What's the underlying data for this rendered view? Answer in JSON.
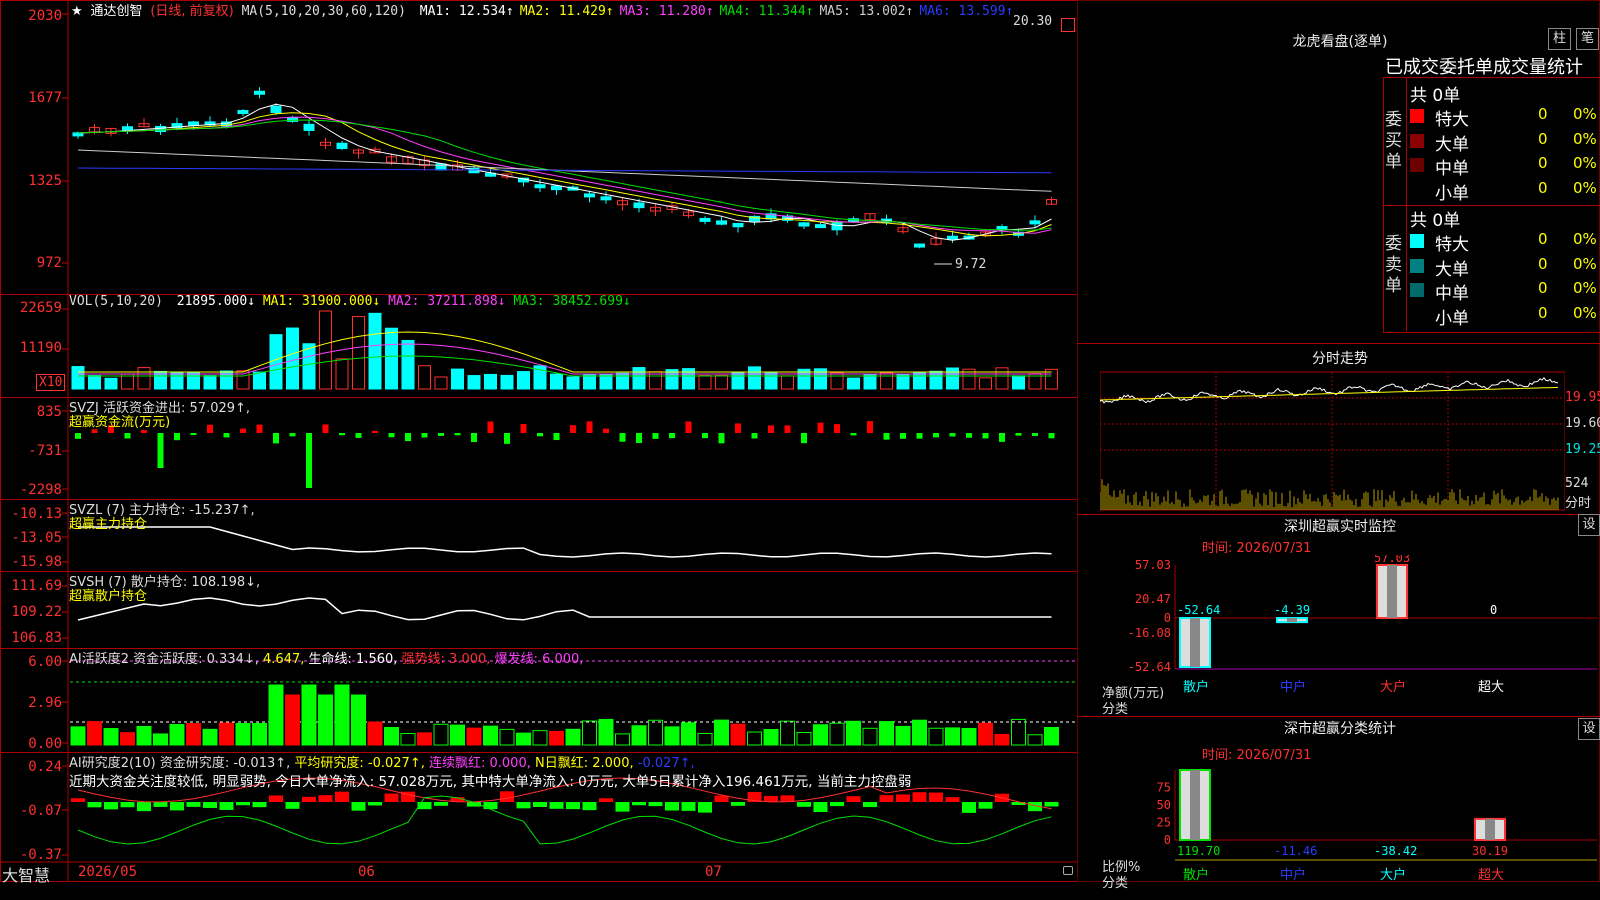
{
  "stock": {
    "star": "★",
    "name": "通达创智",
    "mode": "(日线, 前复权)",
    "ma_label": "MA(5,10,20,30,60,120)",
    "ma_values": [
      {
        "text": "MA1: 12.534↑",
        "color": "#ffffff"
      },
      {
        "text": "MA2: 11.429↑",
        "color": "#ffff00"
      },
      {
        "text": "MA3: 11.280↑",
        "color": "#ff40ff"
      },
      {
        "text": "MA4: 11.344↑",
        "color": "#00e000"
      },
      {
        "text": "MA5: 13.002↑",
        "color": "#cccccc"
      },
      {
        "text": "MA6: 13.599↑",
        "color": "#2a3cff"
      }
    ],
    "price_axis": [
      "2030",
      "1677",
      "1325",
      "972"
    ],
    "high_label": "20.30",
    "low_label": "9.72"
  },
  "vol": {
    "header": "VOL(5,10,20)",
    "v1": "21895.000↓",
    "ma1": "MA1: 31900.000↓",
    "ma2": "MA2: 37211.898↓",
    "ma3": "MA3: 38452.699↓",
    "axis": [
      "22659",
      "11190"
    ],
    "unit": "X10"
  },
  "svzj": {
    "header": "SVZJ  活跃资金进出: 57.029↑,",
    "sub": "超赢资金流(万元)",
    "axis": [
      "835",
      "-731",
      "-2298"
    ]
  },
  "svzl": {
    "header": "SVZL (7) 主力持仓: -15.237↑,",
    "sub": "超赢主力持仓",
    "axis": [
      "-10.13",
      "-13.05",
      "-15.98"
    ]
  },
  "svsh": {
    "header": "SVSH (7) 散户持仓: 108.198↓,",
    "sub": "超赢散户持仓",
    "axis": [
      "111.69",
      "109.22",
      "106.83"
    ]
  },
  "ai2": {
    "label": "AI活跃度2 资金活跃度: 0.334↓,",
    "v2": "4.647,",
    "life": "生命线: 1.560,",
    "strong": "强势线: 3.000,",
    "burst": "爆发线: 6.000,",
    "axis": [
      "6.00",
      "2.96",
      "0.00"
    ]
  },
  "ai_research": {
    "label": "AI研究度2(10) 资金研究度: -0.013↑,",
    "avg": "平均研究度: -0.027↑,",
    "lianxu": "连续飘红: 0.000,",
    "nday": "N日飘红: 2.000,",
    "last": "-0.027↑,",
    "comment": "近期大资金关注度较低, 明显弱势, 今日大单净流入: 57.028万元, 其中特大单净流入: 0万元, 大单5日累计净入196.461万元, 当前主力控盘弱",
    "axis": [
      "0.24",
      "-0.07",
      "-0.37"
    ]
  },
  "xaxis": {
    "brand": "大智慧",
    "labels": [
      "2026/05",
      "06",
      "07"
    ]
  },
  "right": {
    "dragon_title": "龙虎看盘(逐单)",
    "btn_bar": "柱",
    "btn_count": "笔",
    "stat_title": "已成交委托单成交量统计",
    "buy_side": "委买单",
    "sell_side": "委卖单",
    "buy_total": "共 0单",
    "sell_total": "共 0单",
    "buy_rows": [
      {
        "label": "特大",
        "n": "0",
        "pct": "0%",
        "color": "#ff0000"
      },
      {
        "label": "大单",
        "n": "0",
        "pct": "0%",
        "color": "#8b0000"
      },
      {
        "label": "中单",
        "n": "0",
        "pct": "0%",
        "color": "#6a0000"
      },
      {
        "label": "小单",
        "n": "0",
        "pct": "0%",
        "color": "#000000"
      }
    ],
    "sell_rows": [
      {
        "label": "特大",
        "n": "0",
        "pct": "0%",
        "color": "#00ffff"
      },
      {
        "label": "大单",
        "n": "0",
        "pct": "0%",
        "color": "#008080"
      },
      {
        "label": "中单",
        "n": "0",
        "pct": "0%",
        "color": "#006a6a"
      },
      {
        "label": "小单",
        "n": "0",
        "pct": "0%",
        "color": "#000000"
      }
    ],
    "intraday_title": "分时走势",
    "intraday_axis": [
      "19.95",
      "19.60",
      "19.25"
    ],
    "intraday_vol": "524",
    "intraday_unit": "分时",
    "monitor_title": "深圳超赢实时监控",
    "monitor_btn": "设",
    "monitor_time": "时间: 2026/07/31",
    "monitor_axis": [
      "57.03",
      "20.47",
      "0",
      "-16.08",
      "-52.64"
    ],
    "monitor_values": [
      "-52.64",
      "-4.39",
      "57.03",
      "0"
    ],
    "monitor_ylabel": "净额(万元)",
    "monitor_xlabel": "分类",
    "categories": [
      "散户",
      "中户",
      "大户",
      "超大"
    ],
    "stats_title": "深市超赢分类统计",
    "stats_btn": "设",
    "stats_time": "时间: 2026/07/31",
    "stats_axis": [
      "75",
      "50",
      "25",
      "0"
    ],
    "stats_ylabel": "比例%",
    "stats_xlabel": "分类",
    "stats_values": [
      "119.70",
      "-11.46",
      "-38.42",
      "30.19"
    ]
  },
  "chart_data": {
    "type": "bar",
    "title": "深圳超赢实时监控",
    "categories": [
      "散户",
      "中户",
      "大户",
      "超大"
    ],
    "values": [
      -52.64,
      -4.39,
      57.03,
      0
    ],
    "ylim": [
      -52.64,
      57.03
    ]
  }
}
